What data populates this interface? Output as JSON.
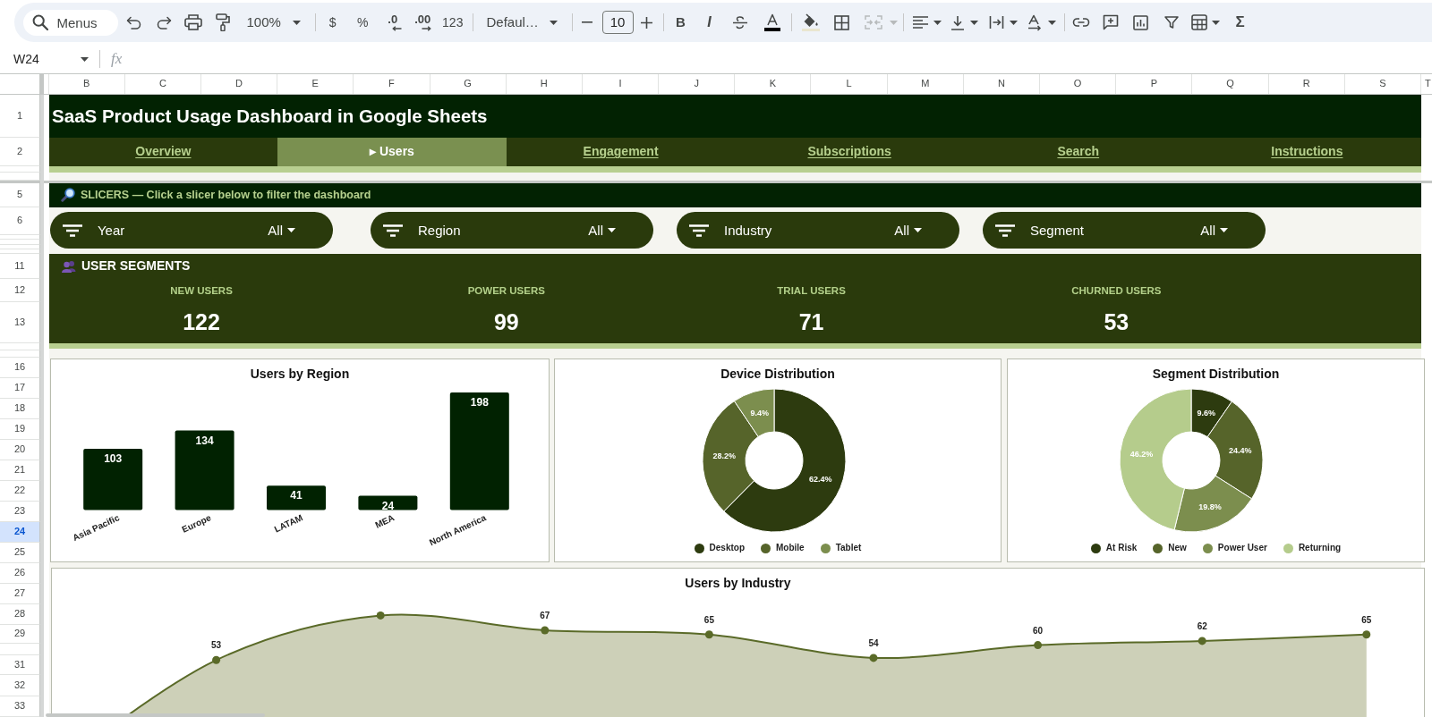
{
  "toolbar": {
    "search": {
      "placeholder": "Menus"
    },
    "zoom": "100%",
    "number_formats": [
      {
        "kind": "text",
        "label": "$"
      },
      {
        "kind": "text",
        "label": "%"
      },
      {
        "kind": "decrease",
        "label": ".0"
      },
      {
        "kind": "increase",
        "label": ".00"
      },
      {
        "kind": "text",
        "label": "123"
      }
    ],
    "font": "Defaul…",
    "font_size": "10",
    "bold": "B",
    "italic": "I",
    "merge": {
      "disabled": true
    },
    "functions": "Σ"
  },
  "formula_bar": {
    "cell": "W24",
    "fx": "fx"
  },
  "column_headers": [
    "B",
    "C",
    "D",
    "E",
    "F",
    "G",
    "H",
    "I",
    "J",
    "K",
    "L",
    "M",
    "N",
    "O",
    "P",
    "Q",
    "R",
    "S",
    "T"
  ],
  "row_headers": [
    {
      "label": "1",
      "selected": false
    },
    {
      "label": "2",
      "selected": false
    },
    {
      "label": "5",
      "selected": false
    },
    {
      "label": "6",
      "selected": false
    },
    {
      "label": "11",
      "selected": false
    },
    {
      "label": "12",
      "selected": false
    },
    {
      "label": "13",
      "selected": false
    },
    {
      "label": "16",
      "selected": false
    },
    {
      "label": "17",
      "selected": false
    },
    {
      "label": "18",
      "selected": false
    },
    {
      "label": "19",
      "selected": false
    },
    {
      "label": "20",
      "selected": false
    },
    {
      "label": "21",
      "selected": false
    },
    {
      "label": "22",
      "selected": false
    },
    {
      "label": "23",
      "selected": false
    },
    {
      "label": "24",
      "selected": true
    },
    {
      "label": "25",
      "selected": false
    },
    {
      "label": "26",
      "selected": false
    },
    {
      "label": "27",
      "selected": false
    },
    {
      "label": "28",
      "selected": false
    },
    {
      "label": "29",
      "selected": false
    },
    {
      "label": "31",
      "selected": false
    },
    {
      "label": "32",
      "selected": false
    },
    {
      "label": "33",
      "selected": false
    }
  ],
  "dashboard": {
    "title": "SaaS Product Usage Dashboard in Google Sheets",
    "nav_tabs": [
      {
        "label": "Overview",
        "selected": false
      },
      {
        "label": "▸ Users",
        "selected": true
      },
      {
        "label": "Engagement",
        "selected": false
      },
      {
        "label": "Subscriptions",
        "selected": false
      },
      {
        "label": "Search",
        "selected": false
      },
      {
        "label": "Instructions",
        "selected": false
      }
    ],
    "slicers": {
      "heading": "SLICERS — Click a slicer below to filter the dashboard",
      "items": [
        {
          "label": "Year",
          "value": "All"
        },
        {
          "label": "Region",
          "value": "All"
        },
        {
          "label": "Industry",
          "value": "All"
        },
        {
          "label": "Segment",
          "value": "All"
        }
      ]
    },
    "user_segments": {
      "heading": "USER SEGMENTS",
      "kpis": [
        {
          "label": "NEW USERS",
          "value": "122"
        },
        {
          "label": "POWER USERS",
          "value": "99"
        },
        {
          "label": "TRIAL USERS",
          "value": "71"
        },
        {
          "label": "CHURNED USERS",
          "value": "53"
        }
      ]
    },
    "charts": [
      {
        "chart_data": {
          "type": "bar",
          "title": "Users by Region",
          "categories": [
            "Asia Pacific",
            "Europe",
            "LATAM",
            "MEA",
            "North America"
          ],
          "values": [
            103,
            134,
            41,
            24,
            198
          ],
          "data_labels": true
        }
      },
      {
        "chart_data": {
          "type": "donut",
          "title": "Device Distribution",
          "categories": [
            "Desktop",
            "Mobile",
            "Tablet"
          ],
          "values": [
            62.4,
            28.2,
            9.4
          ],
          "value_labels": [
            "62.4%",
            "28.2%",
            "9.4%"
          ],
          "colors": [
            "#2d3b0f",
            "#56642a",
            "#7c8e4e"
          ],
          "legend": "bottom"
        }
      },
      {
        "chart_data": {
          "type": "donut",
          "title": "Segment Distribution",
          "categories": [
            "At Risk",
            "New",
            "Power User",
            "Returning"
          ],
          "values": [
            9.6,
            24.4,
            19.8,
            46.2
          ],
          "value_labels": [
            "9.6%",
            "24.4%",
            "19.8%",
            "46.2%"
          ],
          "colors": [
            "#2d3b0f",
            "#56642a",
            "#7c8e4e",
            "#b5cc8c"
          ],
          "legend": "bottom"
        }
      }
    ],
    "industry_chart": {
      "title": "Users by Industry",
      "point_labels": [
        "53",
        "67",
        "65",
        "54",
        "60",
        "62",
        "65"
      ]
    }
  }
}
